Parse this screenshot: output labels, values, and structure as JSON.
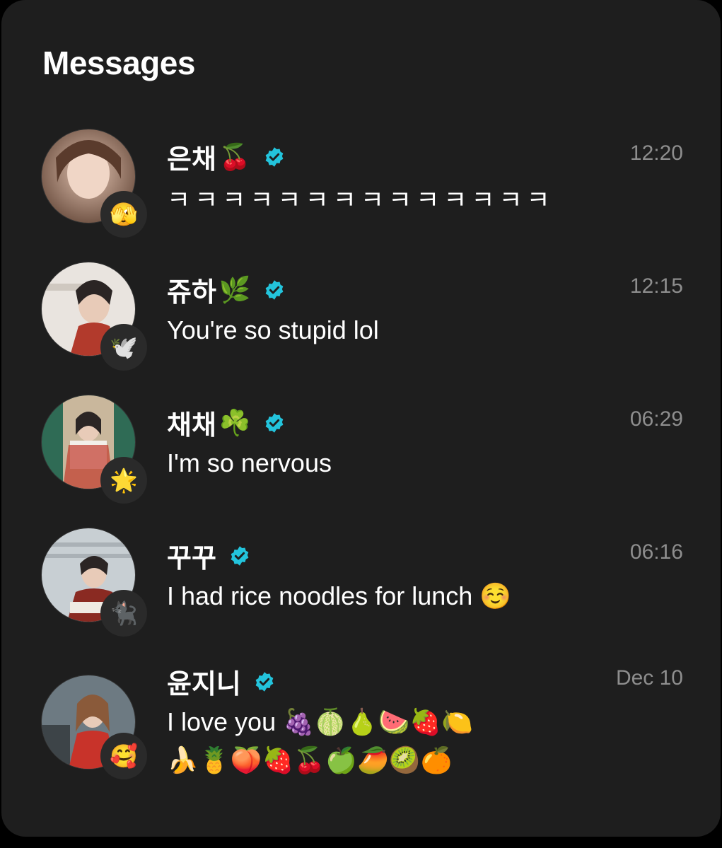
{
  "header": {
    "title": "Messages"
  },
  "verified_color": "#23c4dc",
  "conversations": [
    {
      "name": "은채",
      "name_emoji": "🍒",
      "status_emoji": "🫣",
      "time": "12:20",
      "message": "ㅋㅋㅋㅋㅋㅋㅋㅋㅋㅋㅋㅋㅋㅋ",
      "avatar_colors": [
        "#b59a8c",
        "#6b4e3f"
      ]
    },
    {
      "name": "쥬하",
      "name_emoji": "🌿",
      "status_emoji": "🕊️",
      "time": "12:15",
      "message": "You're so stupid lol",
      "avatar_colors": [
        "#e9e4df",
        "#b23a2c"
      ]
    },
    {
      "name": "채채",
      "name_emoji": "☘️",
      "status_emoji": "🌟",
      "time": "06:29",
      "message": "I'm so nervous",
      "avatar_colors": [
        "#2f6b55",
        "#c9b79c"
      ]
    },
    {
      "name": "꾸꾸",
      "name_emoji": "",
      "status_emoji": "🐈‍⬛",
      "time": "06:16",
      "message": "I had rice noodles for lunch ☺️",
      "avatar_colors": [
        "#c8cfd3",
        "#8a2a22"
      ]
    },
    {
      "name": "윤지니",
      "name_emoji": "",
      "status_emoji": "🥰",
      "time": "Dec 10",
      "message": "I love you 🍇🍈🍐🍉🍓🍋",
      "message_line2": "🍌🍍🍑🍓🍒🍏🥭🥝🍊",
      "avatar_colors": [
        "#6d7a82",
        "#c8332a"
      ]
    }
  ]
}
